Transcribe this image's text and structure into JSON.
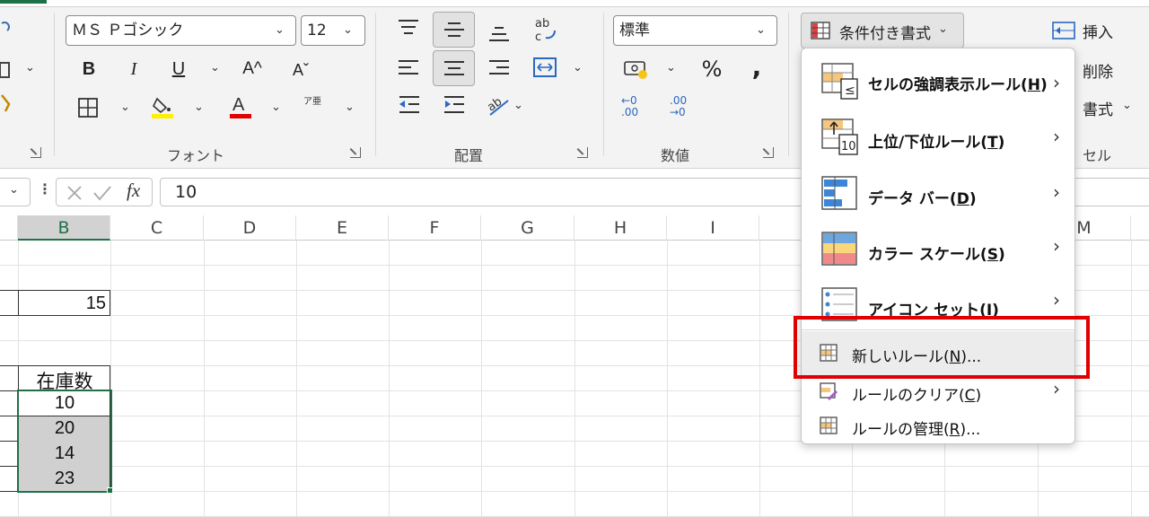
{
  "ribbon": {
    "font_group": {
      "font_name": "ＭＳ Ｐゴシック",
      "font_size": "12",
      "label": "フォント",
      "bold": "B",
      "italic": "I",
      "underline": "U",
      "grow": "A^",
      "shrink": "Aˇ",
      "furigana": "ア亜"
    },
    "alignment_group": {
      "label": "配置"
    },
    "number_group": {
      "format": "標準",
      "label": "数値",
      "percent": "%",
      "comma": ",",
      "inc_decimal": "←0 .00",
      "dec_decimal": ".00 →0"
    },
    "styles": {
      "conditional_formatting": "条件付き書式"
    },
    "cells_group": {
      "insert": "挿入",
      "delete": "削除",
      "format": "書式",
      "label": "セル"
    }
  },
  "formula_bar": {
    "fx": "fx",
    "value": "10"
  },
  "columns": [
    "B",
    "C",
    "D",
    "E",
    "F",
    "G",
    "H",
    "I",
    "M"
  ],
  "cells": {
    "b3": "15",
    "b6": "在庫数",
    "b7": "10",
    "b8": "20",
    "b9": "14",
    "b10": "23"
  },
  "menu": {
    "highlight_rules": {
      "label": "セルの強調表示ルール(",
      "key": "H",
      "end": ")"
    },
    "top_bottom_rules": {
      "label": "上位/下位ルール(",
      "key": "T",
      "end": ")"
    },
    "data_bars": {
      "label": "データ バー(",
      "key": "D",
      "end": ")"
    },
    "color_scales": {
      "label": "カラー スケール(",
      "key": "S",
      "end": ")"
    },
    "icon_sets": {
      "label": "アイコン セット(",
      "key": "I",
      "end": ")"
    },
    "new_rule": {
      "label": "新しいルール(",
      "key": "N",
      "end": ")..."
    },
    "clear_rules": {
      "label": "ルールのクリア(",
      "key": "C",
      "end": ")"
    },
    "manage_rules": {
      "label": "ルールの管理(",
      "key": "R",
      "end": ")..."
    }
  },
  "colors": {
    "accent": "#1e7145",
    "highlight_box": "#e00000",
    "selected_fill": "#d0d0d0"
  }
}
